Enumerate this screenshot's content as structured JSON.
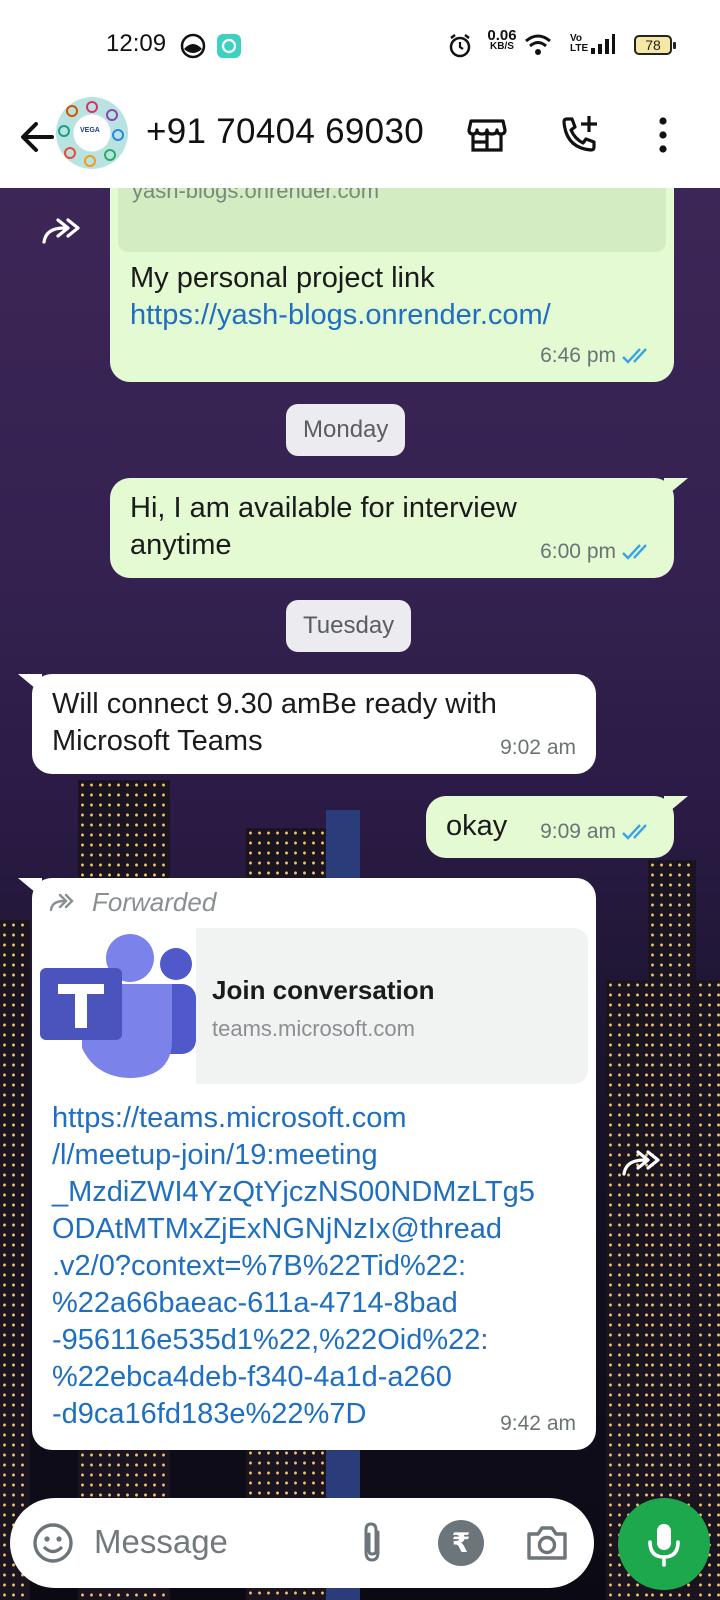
{
  "status_bar": {
    "time": "12:09",
    "net_speed_value": "0.06",
    "net_speed_unit": "KB/S",
    "volte_top": "Vo",
    "volte_bottom": "LTE",
    "battery": "78"
  },
  "header": {
    "contact": "+91 70404 69030",
    "avatar_text": "VEGA"
  },
  "messages": {
    "link_preview_cut": "yash-blogs.onrender.com",
    "project_text": "My personal project link",
    "project_link": "https://yash-blogs.onrender.com/",
    "project_time": "6:46 pm",
    "day1": "Monday",
    "available_line1": "Hi, I am available for interview",
    "available_line2": "anytime",
    "available_time": "6:00 pm",
    "day2": "Tuesday",
    "connect_line1": "Will connect 9.30 amBe ready with",
    "connect_line2": "Microsoft Teams",
    "connect_time": "9:02 am",
    "okay_text": "okay",
    "okay_time": "9:09 am",
    "forwarded_label": "Forwarded",
    "preview_title": "Join conversation",
    "preview_domain": "teams.microsoft.com",
    "teams_link_lines": [
      "https://teams.microsoft.com",
      "/l/meetup-join/19:meeting",
      "_MzdiZWI4YzQtYjczNS00NDMzLTg5",
      "ODAtMTMxZjExNGNjNzIx@thread",
      ".v2/0?context=%7B%22Tid%22:",
      "%22a66baeac-611a-4714-8bad",
      "-956116e535d1%22,%22Oid%22:",
      "%22ebca4deb-f340-4a1d-a260",
      "-d9ca16fd183e%22%7D"
    ],
    "teams_time": "9:42 am"
  },
  "composer": {
    "placeholder": "Message",
    "rupee_symbol": "₹"
  },
  "colors": {
    "outgoing_bubble": "#e3fad3",
    "incoming_bubble": "#ffffff",
    "link": "#1f6fc1",
    "mic_button": "#1ea84e",
    "read_ticks": "#3aa3e3"
  }
}
